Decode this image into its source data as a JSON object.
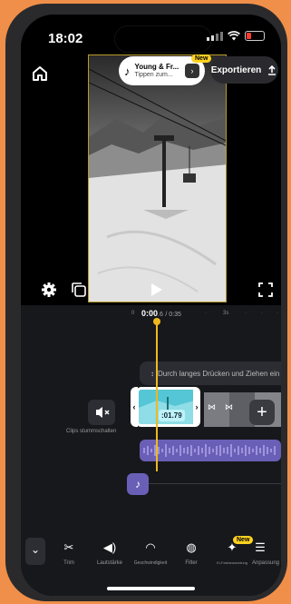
{
  "status": {
    "time": "18:02"
  },
  "header": {
    "music_title": "Young & Fr...",
    "music_subtitle": "Tippen zum...",
    "music_new_badge": "New",
    "export_label": "Exportieren"
  },
  "timeline": {
    "current_time": "0:00",
    "current_frac": ".6",
    "duration": "/ 0:35",
    "tick_0": "0",
    "tick_3s": "3s",
    "hint": "Durch langes Drücken und Ziehen ein",
    "mute_label": "Clips stummschalten",
    "clip_duration": ":01.79"
  },
  "toolbar": {
    "items": [
      {
        "label": "Trim",
        "icon": "scissors-icon"
      },
      {
        "label": "Lautstärke",
        "icon": "volume-icon"
      },
      {
        "label": "Geschwindigkeit",
        "icon": "speedometer-icon"
      },
      {
        "label": "Filter",
        "icon": "filter-icon"
      },
      {
        "label": "KI-Farbanwendung",
        "icon": "ai-color-icon"
      },
      {
        "label": "Anpassung",
        "icon": "sliders-icon"
      }
    ],
    "ai_new_badge": "New"
  },
  "colors": {
    "accent": "#f0b81f",
    "clip": "#4cc3d3",
    "audio": "#6a5fb7",
    "background": "#f08f4a"
  }
}
